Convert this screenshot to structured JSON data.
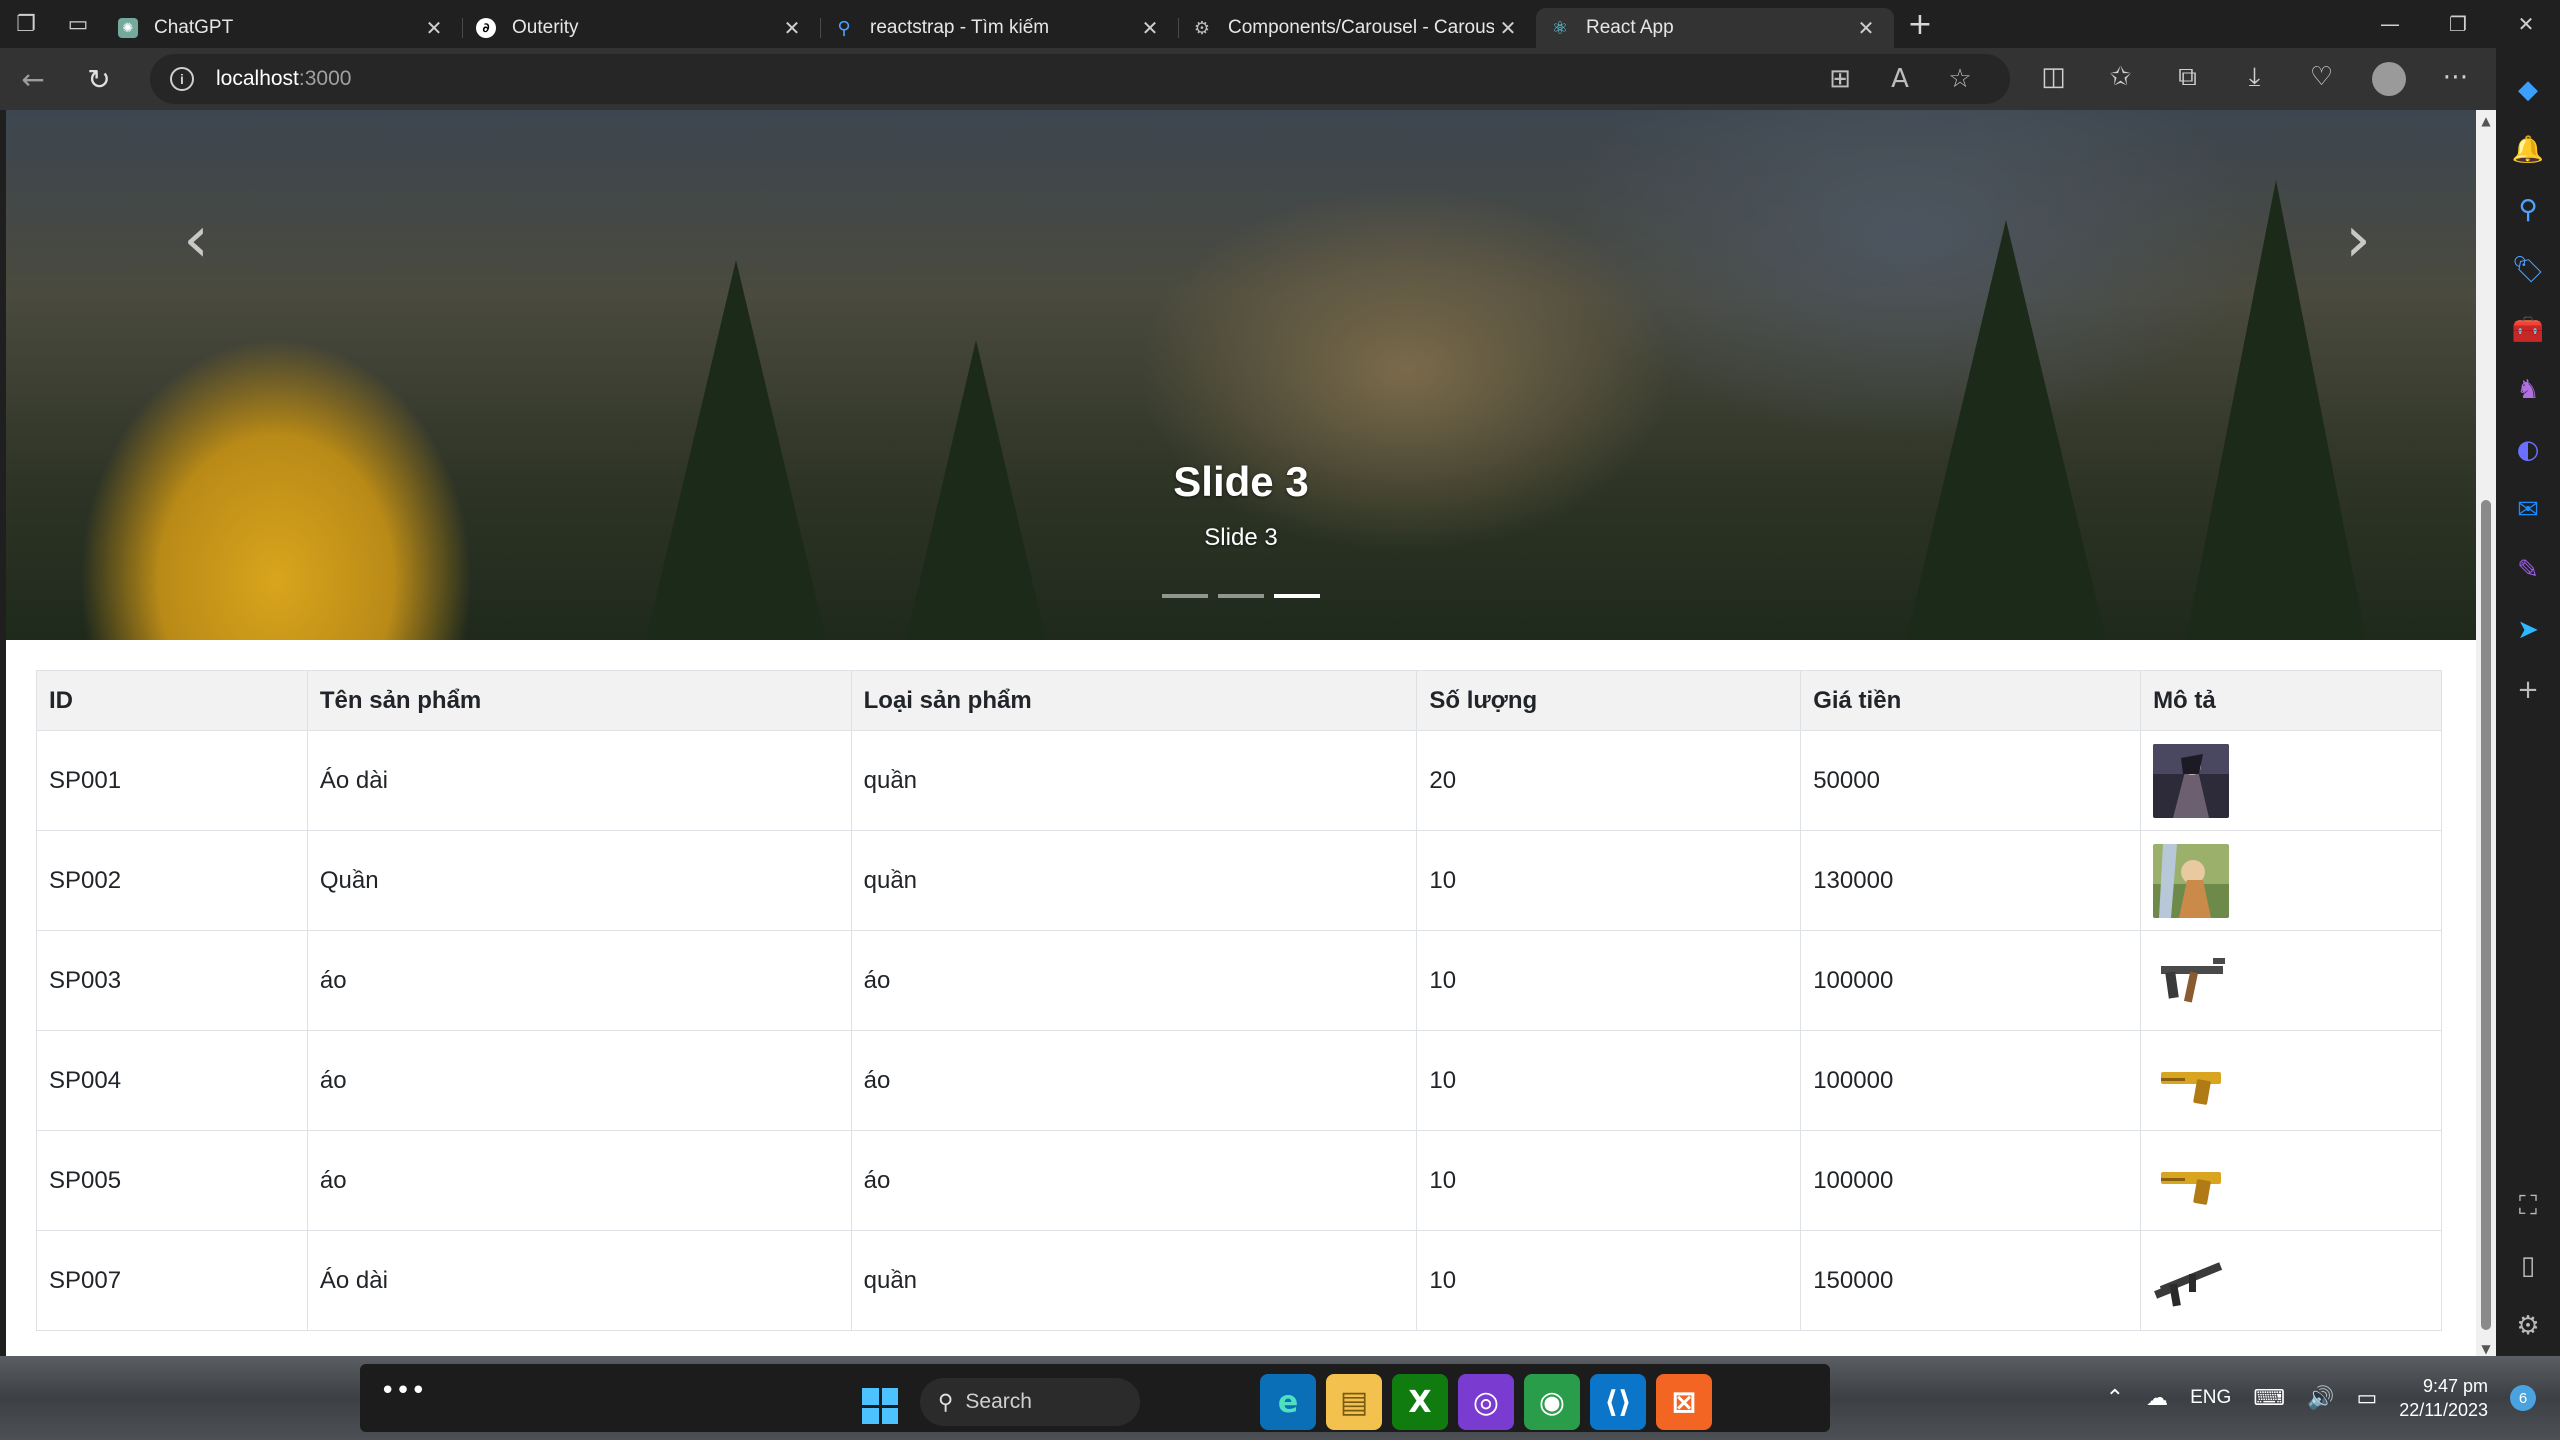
{
  "browser": {
    "tabs": [
      {
        "title": "ChatGPT",
        "icon": "chatgpt-icon",
        "active": false
      },
      {
        "title": "Outerity",
        "icon": "outerity-icon",
        "active": false
      },
      {
        "title": "reactstrap - Tìm kiếm",
        "icon": "search-icon",
        "active": false
      },
      {
        "title": "Components/Carousel - Carouse",
        "icon": "storybook-icon",
        "active": false
      },
      {
        "title": "React App",
        "icon": "react-icon",
        "active": true
      }
    ],
    "address": {
      "host": "localhost",
      "port": ":3000"
    }
  },
  "carousel": {
    "caption_title": "Slide 3",
    "caption_text": "Slide 3",
    "slide_count": 3,
    "active_index": 2
  },
  "table": {
    "headers": [
      "ID",
      "Tên sản phẩm",
      "Loại sản phẩm",
      "Số lượng",
      "Giá tiền",
      "Mô tả"
    ],
    "rows": [
      {
        "id": "SP001",
        "name": "Áo dài",
        "type": "quần",
        "qty": "20",
        "price": "50000",
        "image": "anime-image"
      },
      {
        "id": "SP002",
        "name": "Quần",
        "type": "quần",
        "qty": "10",
        "price": "130000",
        "image": "illustration-image"
      },
      {
        "id": "SP003",
        "name": "áo",
        "type": "áo",
        "qty": "10",
        "price": "100000",
        "image": "rifle-image"
      },
      {
        "id": "SP004",
        "name": "áo",
        "type": "áo",
        "qty": "10",
        "price": "100000",
        "image": "golden-pistol-image"
      },
      {
        "id": "SP005",
        "name": "áo",
        "type": "áo",
        "qty": "10",
        "price": "100000",
        "image": "golden-pistol-image"
      },
      {
        "id": "SP007",
        "name": "Áo dài",
        "type": "quần",
        "qty": "10",
        "price": "150000",
        "image": "assault-rifle-image"
      }
    ]
  },
  "taskbar": {
    "search_label": "Search",
    "language": "ENG",
    "time": "9:47 pm",
    "date": "22/11/2023",
    "notification_count": "6"
  },
  "colors": {
    "accent": "#0d6efd",
    "table_header_bg": "#f2f2f2",
    "toolbar_bg": "#333333",
    "tabstrip_bg": "#202020"
  }
}
